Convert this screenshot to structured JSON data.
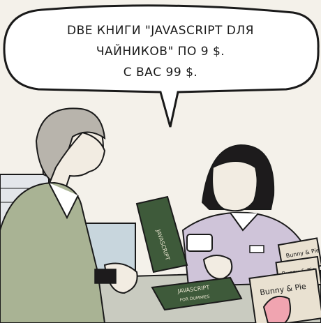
{
  "speech_bubble": {
    "line1": "DBE КНИГИ \"JAVASCRIPT DЛЯ",
    "line2": "ЧАЙНИКОВ\" ПО 9 $.",
    "line3": "С ВАС 99 $."
  },
  "book_covers": {
    "held_book_title": "JAVASCRIPT",
    "counter_book_title": "JAVASCRIPT",
    "counter_book_subtitle": "FOR DUMMIES"
  },
  "shelf_labels": [
    "Bunny & Pie",
    "Bunny & Pie",
    "Bunny & Pie"
  ],
  "colors": {
    "background": "#f4f1ea",
    "outline": "#1a1a1a",
    "cashier_shirt": "#cfc4d9",
    "customer_jacket": "#a9b394",
    "counter": "#c9cbc0",
    "monitor": "#c8d6dd",
    "book_cover": "#3e5a3a"
  }
}
